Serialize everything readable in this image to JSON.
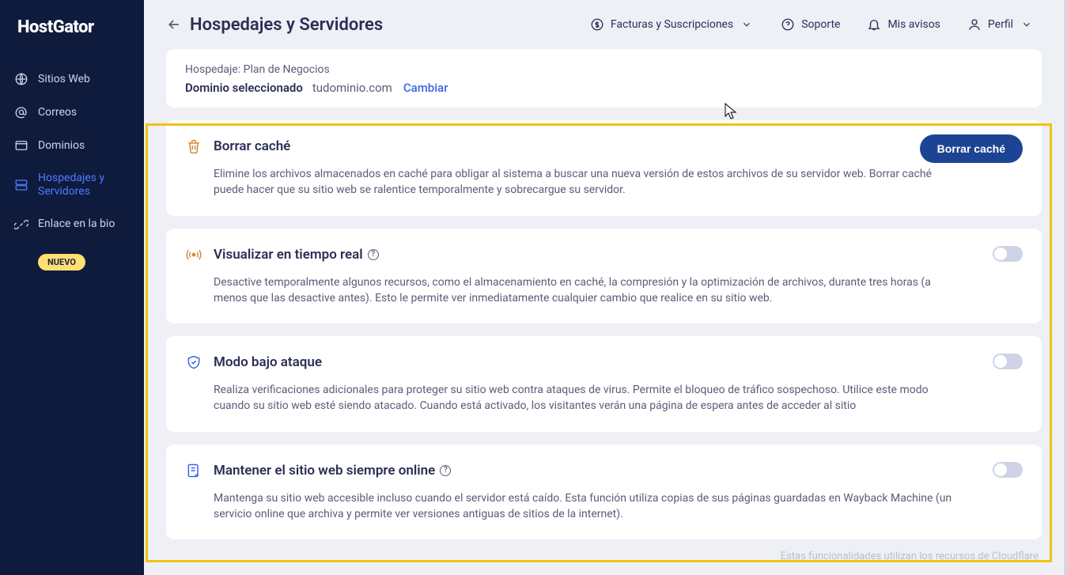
{
  "logo": "HostGator",
  "nav": {
    "sitios": "Sitios Web",
    "correos": "Correos",
    "dominios": "Dominios",
    "hospedajes": "Hospedajes y Servidores",
    "enlace": "Enlace en la bio",
    "nuevo_badge": "NUEVO"
  },
  "header": {
    "title": "Hospedajes y Servidores",
    "facturas": "Facturas y Suscripciones",
    "soporte": "Soporte",
    "avisos": "Mis avisos",
    "perfil": "Perfil"
  },
  "info": {
    "hosting_label": "Hospedaje:",
    "hosting_plan": "Plan de Negocios",
    "domain_label": "Dominio seleccionado",
    "domain_value": "tudominio.com",
    "change": "Cambiar"
  },
  "settings": {
    "clear_cache": {
      "title": "Borrar caché",
      "button": "Borrar caché",
      "desc": "Elimine los archivos almacenados en caché para obligar al sistema a buscar una nueva versión de estos archivos de su servidor web. Borrar caché puede hacer que su sitio web se ralentice temporalmente y sobrecargue su servidor."
    },
    "realtime": {
      "title": "Visualizar en tiempo real",
      "desc": "Desactive temporalmente algunos recursos, como el almacenamiento en caché, la compresión y la optimización de archivos, durante tres horas (a menos que las desactive antes). Esto le permite ver inmediatamente cualquier cambio que realice en su sitio web."
    },
    "attack": {
      "title": "Modo bajo ataque",
      "desc": "Realiza verificaciones adicionales para proteger su sitio web contra ataques de virus. Permite el bloqueo de tráfico sospechoso. Utilice este modo cuando su sitio web esté siendo atacado. Cuando está activado, los visitantes verán una página de espera antes de acceder al sitio"
    },
    "always_online": {
      "title": "Mantener el sitio web siempre online",
      "desc": "Mantenga su sitio web accesible incluso cuando el servidor está caído. Esta función utiliza copias de sus páginas guardadas en Wayback Machine (un servicio online que archiva y permite ver versiones antiguas de sitios de la internet)."
    }
  },
  "footer": "Estas funcionalidades utilizan los recursos de Cloudflare"
}
